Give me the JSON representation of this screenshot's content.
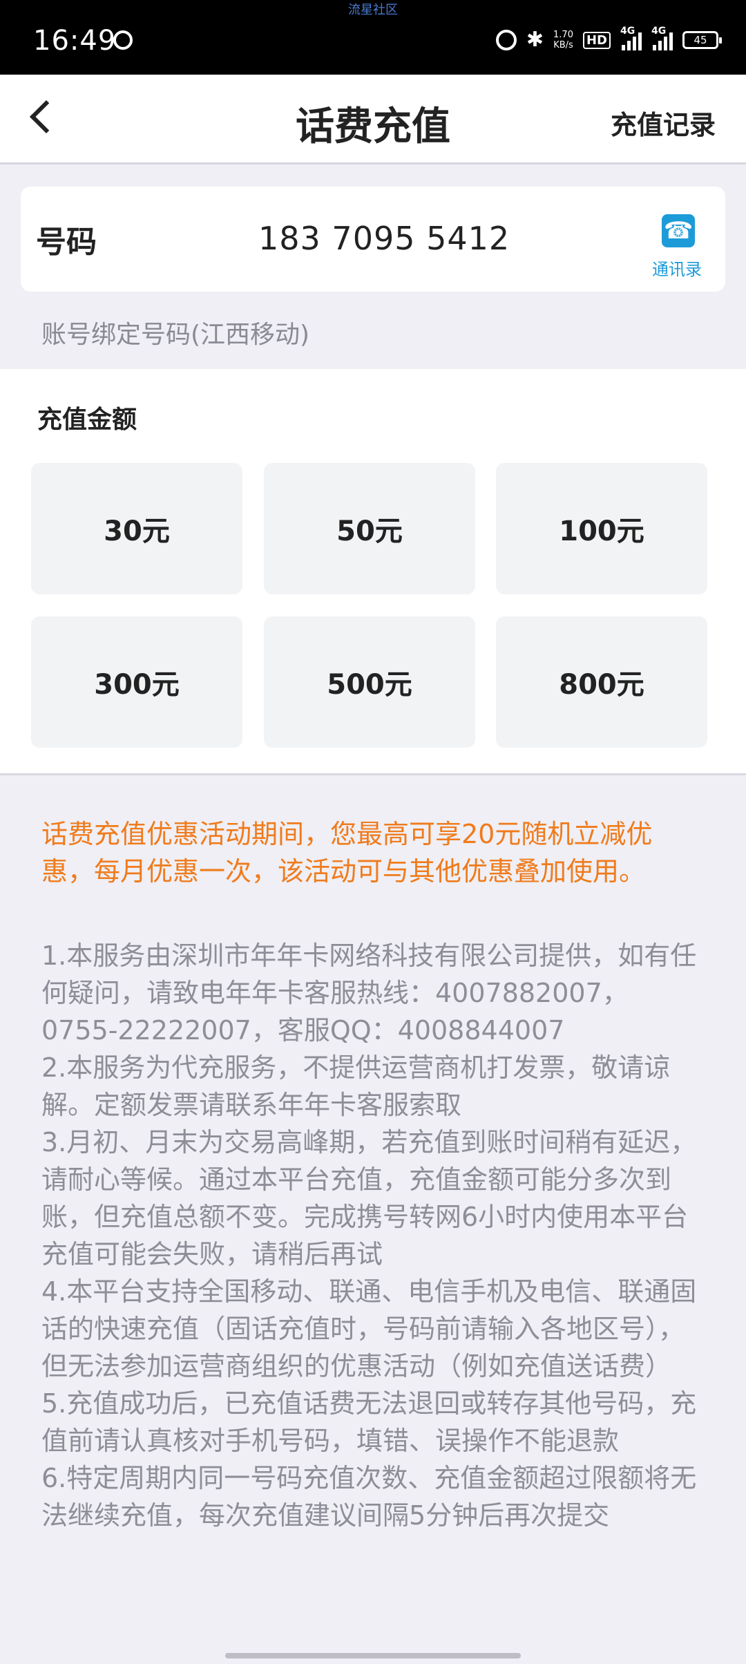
{
  "status_bar": {
    "time": "16:49",
    "watermark": "流星社区",
    "net_speed": "1.70",
    "net_unit": "KB/s",
    "hd": "HD",
    "sim1_type": "4G",
    "sim2_type": "4G",
    "battery": "45"
  },
  "header": {
    "title": "话费充值",
    "record_label": "充值记录"
  },
  "phone": {
    "label": "号码",
    "number": "183 7095 5412",
    "contacts_label": "通讯录",
    "bound_note": "账号绑定号码(江西移动)"
  },
  "amount": {
    "title": "充值金额",
    "options": [
      "30元",
      "50元",
      "100元",
      "300元",
      "500元",
      "800元"
    ]
  },
  "promo_text": "话费充值优惠活动期间，您最高可享20元随机立减优惠，每月优惠一次，该活动可与其他优惠叠加使用。",
  "rules": [
    "1.本服务由深圳市年年卡网络科技有限公司提供，如有任何疑问，请致电年年卡客服热线：4007882007，0755-22222007，客服QQ：4008844007",
    "2.本服务为代充服务，不提供运营商机打发票，敬请谅解。定额发票请联系年年卡客服索取",
    "3.月初、月末为交易高峰期，若充值到账时间稍有延迟，请耐心等候。通过本平台充值，充值金额可能分多次到账，但充值总额不变。完成携号转网6小时内使用本平台充值可能会失败，请稍后再试",
    "4.本平台支持全国移动、联通、电信手机及电信、联通固话的快速充值（固话充值时，号码前请输入各地区号），但无法参加运营商组织的优惠活动（例如充值送话费）",
    "5.充值成功后，已充值话费无法退回或转存其他号码，充值前请认真核对手机号码，填错、误操作不能退款",
    "6.特定周期内同一号码充值次数、充值金额超过限额将无法继续充值，每次充值建议间隔5分钟后再次提交"
  ],
  "colors": {
    "accent_blue": "#1d9bd9",
    "promo_orange": "#f07b1c",
    "muted_text": "#8e8e98"
  }
}
